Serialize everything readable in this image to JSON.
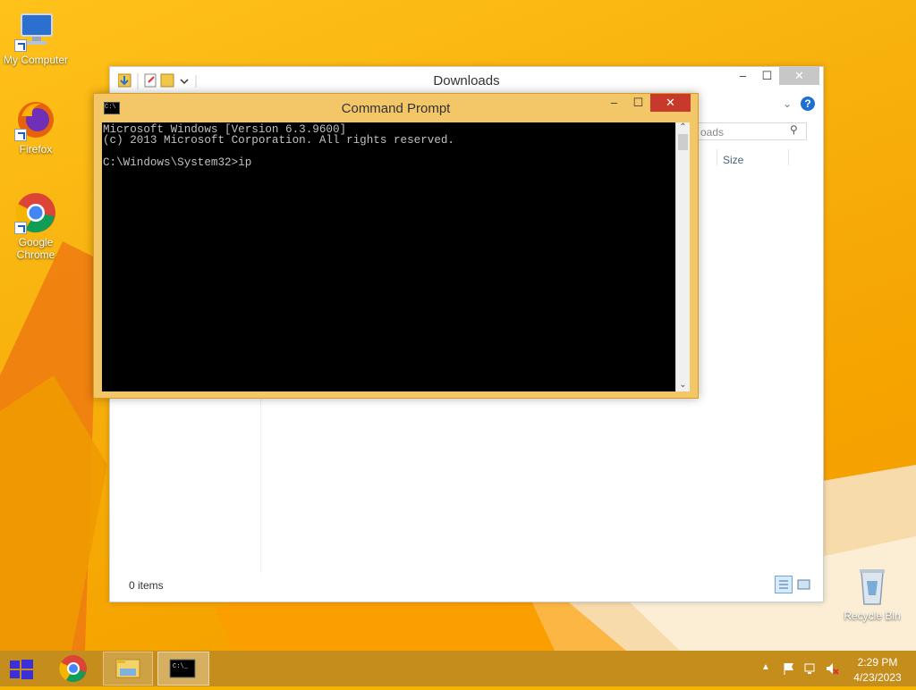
{
  "desktop": {
    "icons": [
      {
        "label": "My Computer",
        "icon": "my-computer-icon"
      },
      {
        "label": "Firefox",
        "icon": "firefox-icon"
      },
      {
        "label": "Google\nChrome",
        "icon": "chrome-icon"
      },
      {
        "label": "Recycle Bin",
        "icon": "recycle-bin-icon"
      }
    ]
  },
  "explorer": {
    "title": "Downloads",
    "search_placeholder": "oads",
    "column_size": "Size",
    "status": "0 items",
    "controls": {
      "minimize": "–",
      "maximize": "☐",
      "close": "✕"
    }
  },
  "cmd": {
    "title": "Command Prompt",
    "lines": [
      "Microsoft Windows [Version 6.3.9600]",
      "(c) 2013 Microsoft Corporation. All rights reserved.",
      "",
      "C:\\Windows\\System32>ip"
    ],
    "controls": {
      "minimize": "–",
      "maximize": "☐",
      "close": "✕"
    }
  },
  "taskbar": {
    "time": "2:29 PM",
    "date": "4/23/2023",
    "apps": [
      "start",
      "chrome",
      "file-explorer",
      "command-prompt"
    ]
  },
  "colors": {
    "accent": "#f6b300",
    "cmd_frame": "#f3c767",
    "close_red": "#c7392b",
    "taskbar": "#c48d1c"
  }
}
